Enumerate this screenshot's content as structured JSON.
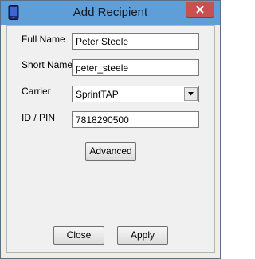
{
  "window": {
    "title": "Add Recipient"
  },
  "form": {
    "full_name": {
      "label": "Full Name",
      "value": "Peter Steele"
    },
    "short_name": {
      "label": "Short Name",
      "value": "peter_steele"
    },
    "carrier": {
      "label": "Carrier",
      "value": "SprintTAP"
    },
    "id_pin": {
      "label": "ID / PIN",
      "value": "7818290500"
    }
  },
  "buttons": {
    "advanced": "Advanced",
    "close": "Close",
    "apply": "Apply"
  },
  "colors": {
    "titlebar": "#5f9ed6",
    "close_button": "#c85050",
    "dialog_bg": "#f0f0f0"
  }
}
